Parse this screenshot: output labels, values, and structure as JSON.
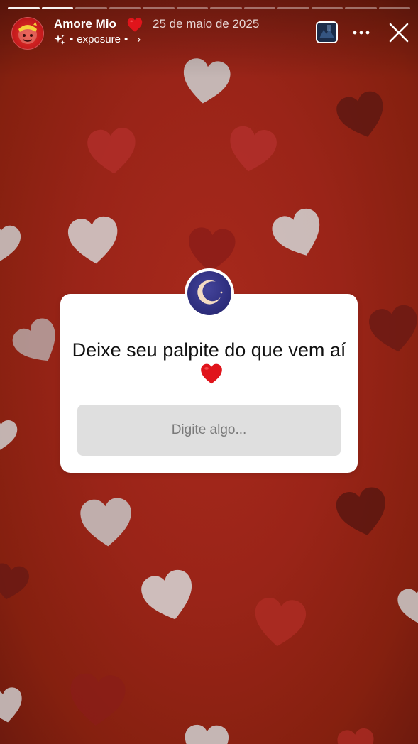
{
  "progress": {
    "total_segments": 12,
    "completed_segments": 2
  },
  "header": {
    "account_name": "Amore Mio",
    "date": "25 de maio de 2025",
    "audio_label": "exposure",
    "separator": "•"
  },
  "question_sticker": {
    "question": "Deixe seu palpite do que vem aí",
    "answer_placeholder": "Digite algo..."
  },
  "icons": {
    "name_heart": "red-heart-emoji",
    "question_heart": "red-heart-emoji",
    "sparkle": "sparkle-icon",
    "more": "more-horizontal-icon",
    "close": "close-icon",
    "chevron": "chevron-right-icon"
  },
  "colors": {
    "background": "#9a2418",
    "heart_emoji": "#e0141b",
    "sticker_background": "#ffffff",
    "input_background": "#dfdfdf",
    "sticker_avatar": "#2f2f7f"
  }
}
